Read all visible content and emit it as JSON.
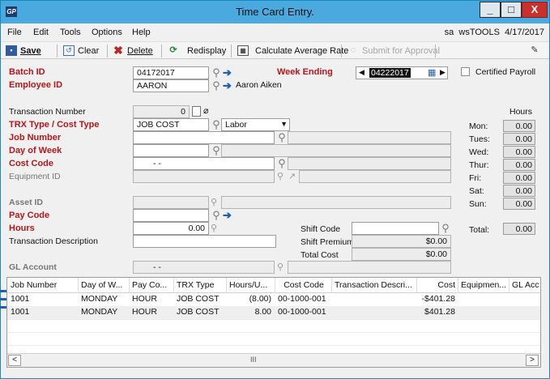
{
  "window": {
    "app_icon": "GP",
    "title": "Time Card Entry.",
    "controls": [
      "minimize",
      "maximize",
      "close"
    ]
  },
  "menu": {
    "items": [
      "File",
      "Edit",
      "Tools",
      "Options",
      "Help"
    ],
    "user": "sa",
    "company": "wsTOOLS",
    "date": "4/17/2017"
  },
  "toolbar": {
    "save": "Save",
    "clear": "Clear",
    "delete": "Delete",
    "redisplay": "Redisplay",
    "calc_avg": "Calculate Average Rate",
    "submit": "Submit for Approval"
  },
  "header": {
    "batch_id_label": "Batch ID",
    "batch_id": "04172017",
    "week_ending_label": "Week Ending",
    "week_ending": "04222017",
    "employee_id_label": "Employee ID",
    "employee_id": "AARON",
    "employee_name": "Aaron Aiken",
    "certified_payroll_label": "Certified Payroll"
  },
  "entry": {
    "trx_number_label": "Transaction Number",
    "trx_number": "0",
    "trx_type_label": "TRX Type / Cost Type",
    "trx_type": "JOB COST",
    "cost_type": "Labor",
    "job_number_label": "Job Number",
    "day_of_week_label": "Day of Week",
    "cost_code_label": "Cost Code",
    "cost_code_value": "-      -",
    "equipment_id_label": "Equipment ID",
    "asset_id_label": "Asset ID",
    "pay_code_label": "Pay Code",
    "hours_label": "Hours",
    "hours_value": "0.00",
    "trx_desc_label": "Transaction Description",
    "shift_code_label": "Shift Code",
    "shift_premium_label": "Shift Premium",
    "shift_premium": "$0.00",
    "total_cost_label": "Total Cost",
    "total_cost": "$0.00",
    "gl_account_label": "GL Account",
    "gl_account_value": "-      -"
  },
  "hours_panel": {
    "title": "Hours",
    "days": [
      {
        "label": "Mon:",
        "value": "0.00"
      },
      {
        "label": "Tues:",
        "value": "0.00"
      },
      {
        "label": "Wed:",
        "value": "0.00"
      },
      {
        "label": "Thur:",
        "value": "0.00"
      },
      {
        "label": "Fri:",
        "value": "0.00"
      },
      {
        "label": "Sat:",
        "value": "0.00"
      },
      {
        "label": "Sun:",
        "value": "0.00"
      }
    ],
    "total_label": "Total:",
    "total_value": "0.00"
  },
  "grid": {
    "columns": [
      "Job Number",
      "Day of W...",
      "Pay Co...",
      "TRX Type",
      "Hours/U...",
      "Cost Code",
      "Transaction Descri...",
      "Cost",
      "Equipmen...",
      "GL Acc"
    ],
    "rows": [
      [
        "1001",
        "MONDAY",
        "HOUR",
        "JOB COST",
        "(8.00)",
        "00-1000-001",
        "",
        "-$401.28",
        "",
        ""
      ],
      [
        "1001",
        "MONDAY",
        "HOUR",
        "JOB COST",
        "8.00",
        "00-1000-001",
        "",
        "$401.28",
        "",
        ""
      ]
    ]
  },
  "colors": {
    "titlebar": "#4aa9df",
    "required_label": "#b3171c",
    "close_button": "#c9302c"
  }
}
